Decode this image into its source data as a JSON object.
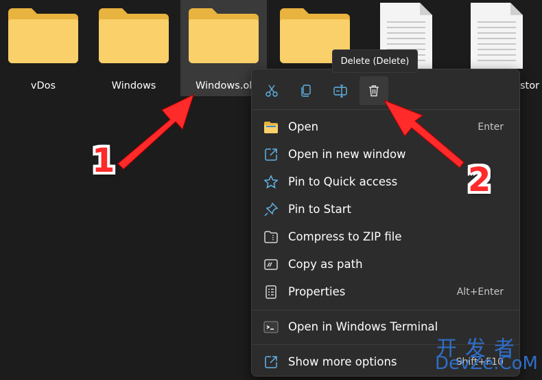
{
  "files": [
    {
      "name": "vDos",
      "type": "folder"
    },
    {
      "name": "Windows",
      "type": "folder"
    },
    {
      "name": "Windows.old",
      "type": "folder",
      "selected": true
    },
    {
      "name": "",
      "type": "folder"
    },
    {
      "name": "",
      "type": "document"
    },
    {
      "name": "stor",
      "type": "document"
    }
  ],
  "tooltip": "Delete (Delete)",
  "toolbar": {
    "cut": "scissors-icon",
    "copy": "copy-icon",
    "rename": "rename-icon",
    "delete": "trash-icon"
  },
  "menu": {
    "items": [
      {
        "label": "Open",
        "shortcut": "Enter",
        "icon": "folder-icon"
      },
      {
        "label": "Open in new window",
        "shortcut": "",
        "icon": "open-external-icon"
      },
      {
        "label": "Pin to Quick access",
        "shortcut": "",
        "icon": "star-icon"
      },
      {
        "label": "Pin to Start",
        "shortcut": "",
        "icon": "pin-icon"
      },
      {
        "label": "Compress to ZIP file",
        "shortcut": "",
        "icon": "zip-icon"
      },
      {
        "label": "Copy as path",
        "shortcut": "",
        "icon": "path-icon"
      },
      {
        "label": "Properties",
        "shortcut": "Alt+Enter",
        "icon": "properties-icon"
      },
      {
        "label": "Open in Windows Terminal",
        "shortcut": "",
        "icon": "terminal-icon"
      },
      {
        "label": "Show more options",
        "shortcut": "Shift+F10",
        "icon": "more-options-icon"
      }
    ]
  },
  "annotations": {
    "badge1": "1",
    "badge2": "2"
  },
  "watermark": {
    "cn": "开发者",
    "en": "DevZe.CoM"
  },
  "colors": {
    "background": "#1c1c1c",
    "menu": "#2c2c2c",
    "folder": "#f8cd5a",
    "arrow": "#ff2a2a",
    "accent": "#60b4e8"
  }
}
